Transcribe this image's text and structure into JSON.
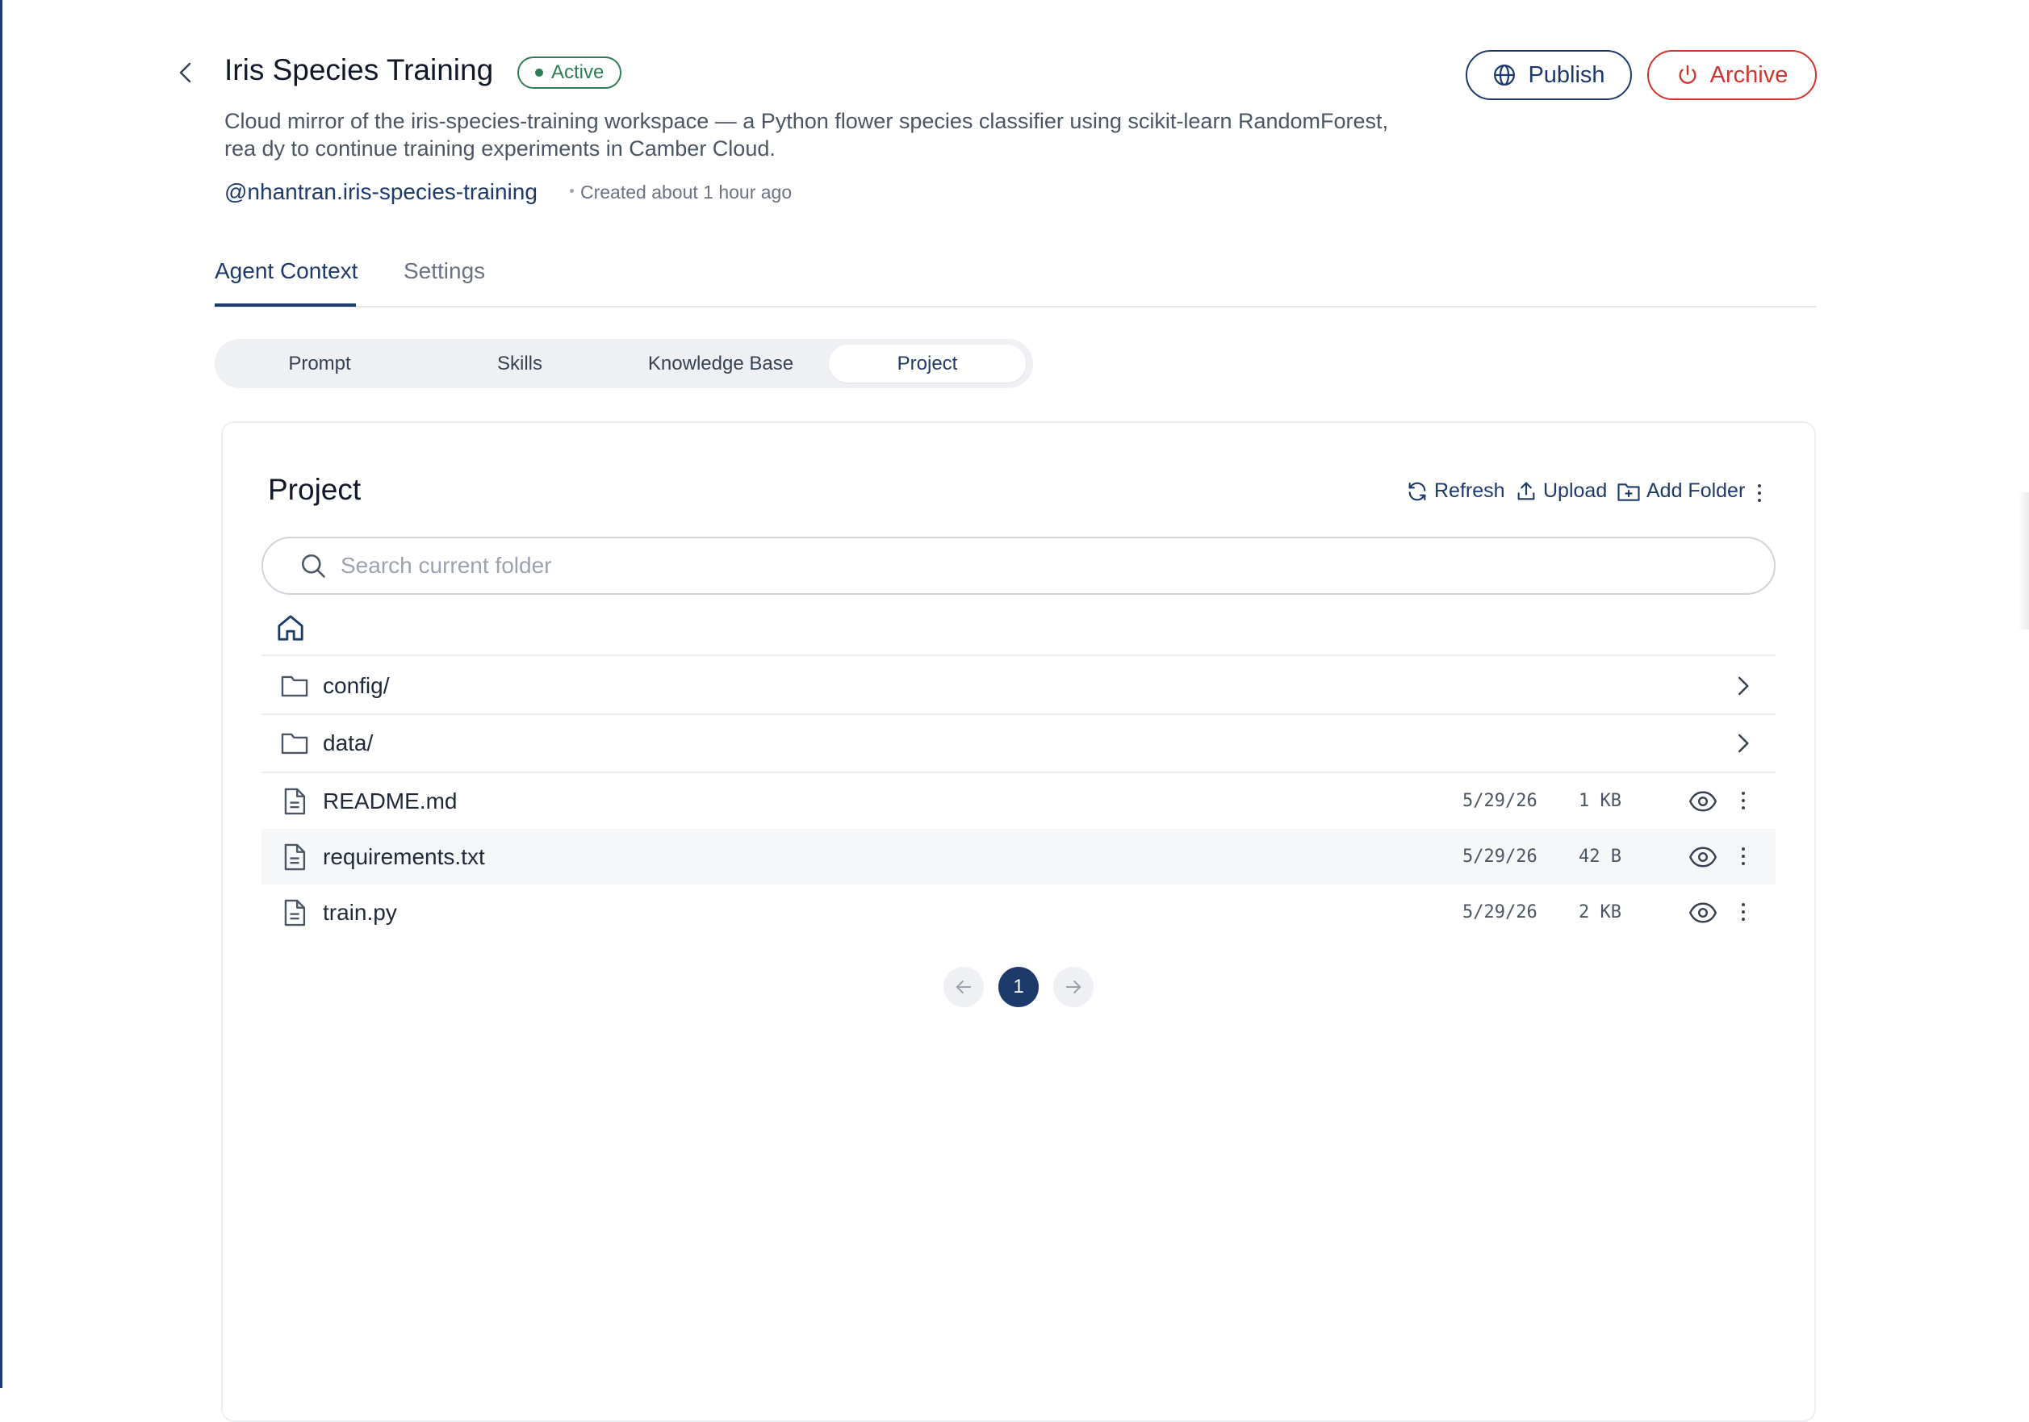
{
  "header": {
    "title": "Iris Species Training",
    "status": "Active",
    "description": "Cloud mirror of the iris-species-training workspace — a Python flower species classifier using scikit-learn RandomForest, rea dy to continue training experiments in Camber Cloud.",
    "handle": "@nhantran.iris-species-training",
    "created": "Created about 1 hour ago",
    "publish_label": "Publish",
    "archive_label": "Archive"
  },
  "tabs": [
    {
      "label": "Agent Context",
      "active": true
    },
    {
      "label": "Settings",
      "active": false
    }
  ],
  "segments": [
    {
      "label": "Prompt",
      "active": false
    },
    {
      "label": "Skills",
      "active": false
    },
    {
      "label": "Knowledge Base",
      "active": false
    },
    {
      "label": "Project",
      "active": true
    }
  ],
  "project": {
    "title": "Project",
    "actions": {
      "refresh": "Refresh",
      "upload": "Upload",
      "add_folder": "Add Folder"
    },
    "search_placeholder": "Search current folder",
    "folders": [
      {
        "name": "config/"
      },
      {
        "name": "data/"
      }
    ],
    "files": [
      {
        "name": "README.md",
        "date": "5/29/26",
        "size": "1 KB"
      },
      {
        "name": "requirements.txt",
        "date": "5/29/26",
        "size": "42 B"
      },
      {
        "name": "train.py",
        "date": "5/29/26",
        "size": "2 KB"
      }
    ],
    "pagination": {
      "current_page": "1"
    }
  },
  "colors": {
    "primary": "#1e3a6b",
    "success": "#2e7d55",
    "danger": "#d0342c"
  }
}
